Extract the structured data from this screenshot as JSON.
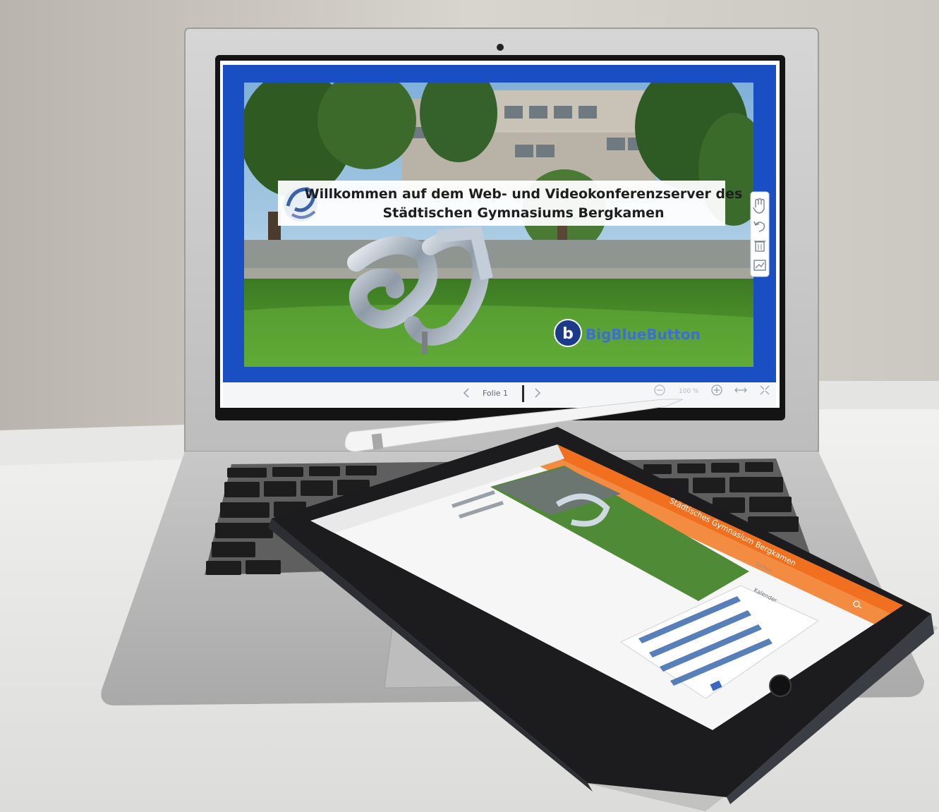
{
  "slide": {
    "title_line1": "Willkommen auf dem Web- und Videokonferenzserver des",
    "title_line2": "Städtischen Gymnasiums Bergkamen",
    "brand": "BigBlueButton"
  },
  "presentation_toolbar": {
    "slide_label": "Folie 1",
    "zoom_level": "100 %"
  },
  "tablet": {
    "site_title": "Städtisches Gymnasium Bergkamen",
    "search_label": "Suchen",
    "calendar_title": "Kalender"
  },
  "colors": {
    "bbb_blue": "#1a4fc4",
    "tablet_orange": "#f07020",
    "desk": "#ededeb",
    "wall": "#cfcbc5"
  }
}
